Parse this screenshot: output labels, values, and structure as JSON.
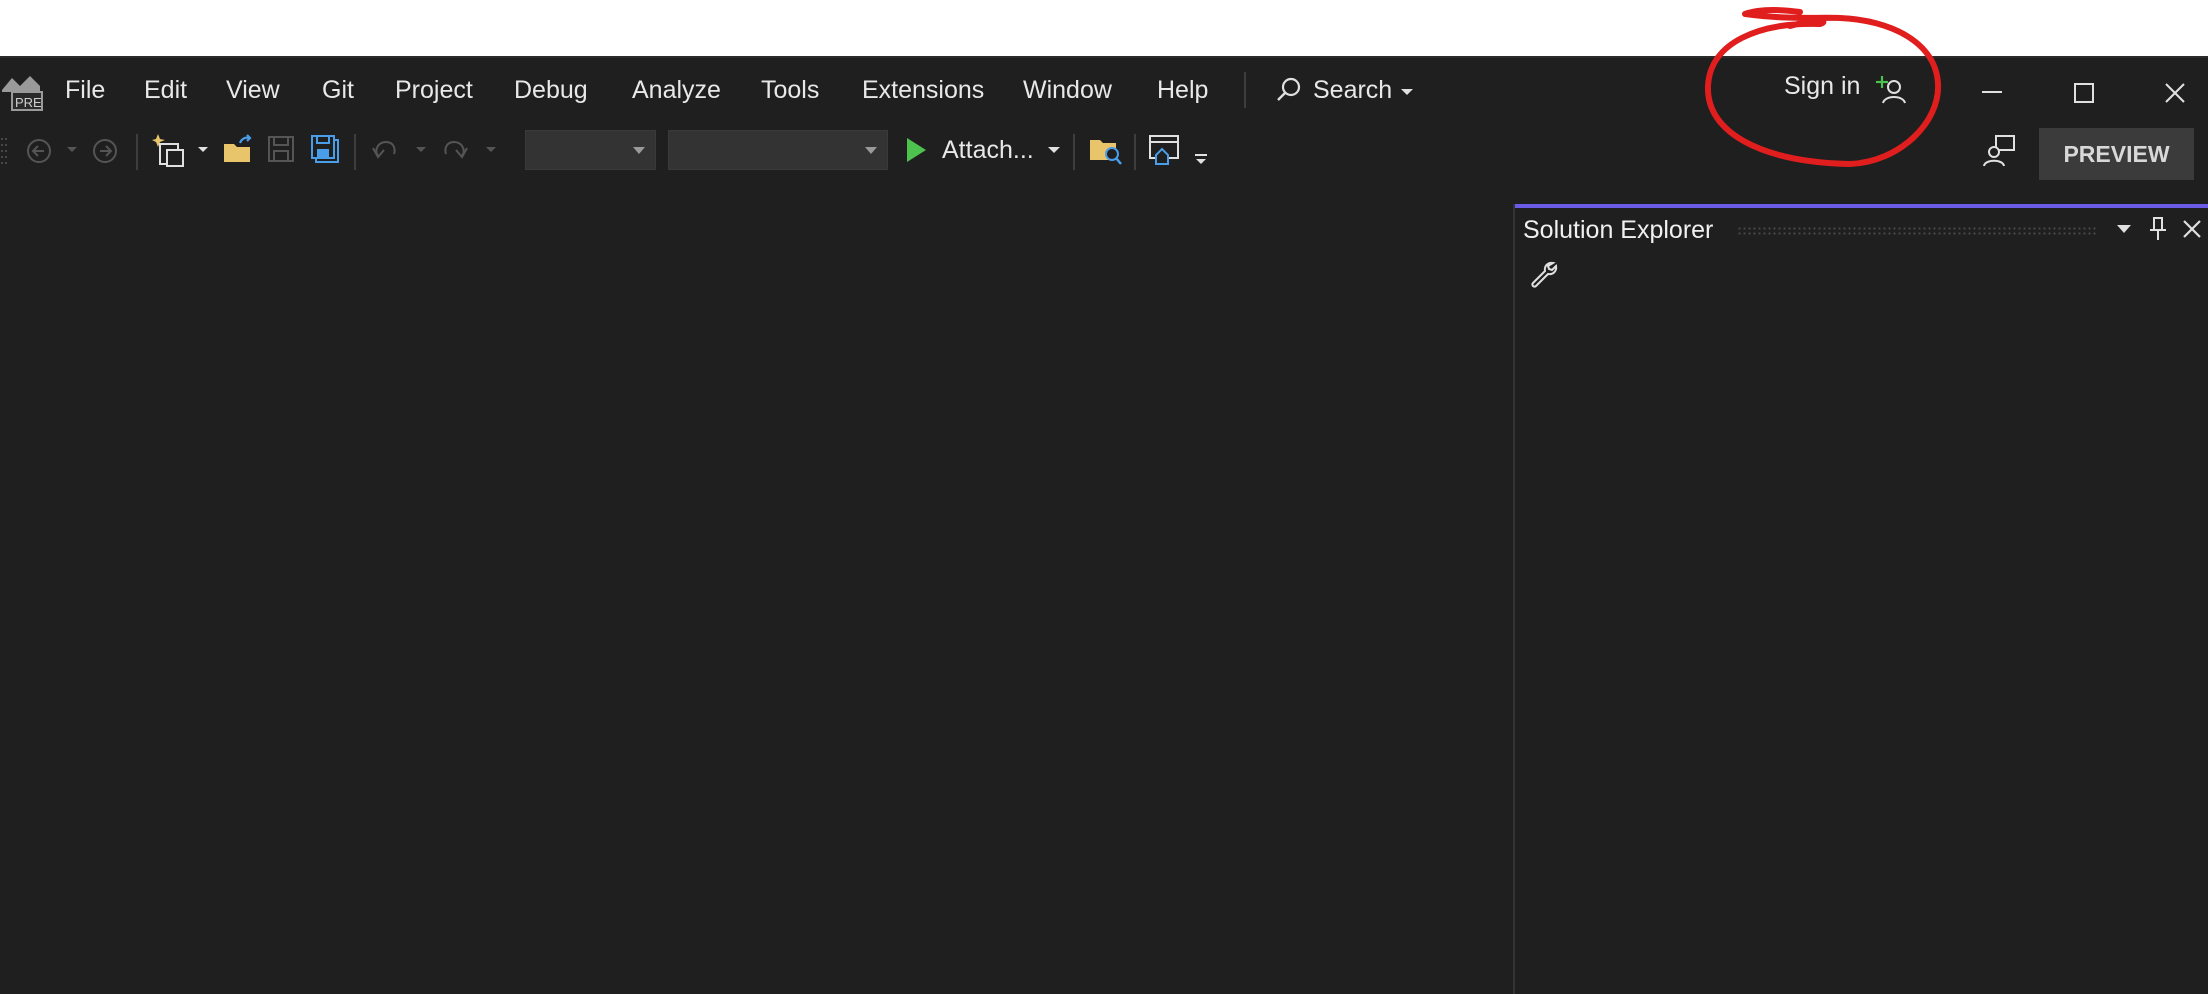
{
  "menu": {
    "items": [
      {
        "id": "file",
        "label": "File"
      },
      {
        "id": "edit",
        "label": "Edit"
      },
      {
        "id": "view",
        "label": "View"
      },
      {
        "id": "git",
        "label": "Git"
      },
      {
        "id": "project",
        "label": "Project"
      },
      {
        "id": "debug",
        "label": "Debug"
      },
      {
        "id": "analyze",
        "label": "Analyze"
      },
      {
        "id": "tools",
        "label": "Tools"
      },
      {
        "id": "extensions",
        "label": "Extensions"
      },
      {
        "id": "window",
        "label": "Window"
      },
      {
        "id": "help",
        "label": "Help"
      }
    ],
    "search_label": "Search",
    "signin_label": "Sign in",
    "logo_badge": "PRE"
  },
  "toolbar": {
    "attach_label": "Attach...",
    "preview_label": "PREVIEW",
    "config_combo_value": "",
    "platform_combo_value": ""
  },
  "solution_explorer": {
    "title": "Solution Explorer"
  },
  "colors": {
    "accent": "#6b5ce7",
    "run_green": "#4ec24e",
    "annotation_red": "#e01e1e",
    "folder_yellow": "#e8c46a",
    "save_blue": "#4a9de8"
  }
}
